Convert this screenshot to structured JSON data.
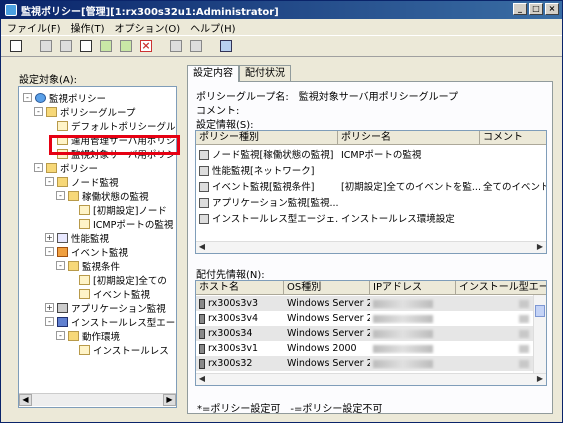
{
  "window": {
    "title": "監視ポリシー[管理][1:rx300s32u1:Administrator]"
  },
  "menu": [
    "ファイル(F)",
    "操作(T)",
    "オプション(O)",
    "ヘルプ(H)"
  ],
  "left": {
    "label": "設定対象(A):",
    "tree": [
      {
        "label": "監視ポリシー",
        "icon": "globe-icon",
        "level": 0,
        "exp": "-"
      },
      {
        "label": "ポリシーグループ",
        "icon": "folder-icon",
        "level": 1,
        "exp": "-"
      },
      {
        "label": "デフォルトポリシーグル",
        "icon": "doc-icon",
        "level": 2,
        "exp": ""
      },
      {
        "label": "運用管理サーバ用ポリシ",
        "icon": "doc-icon",
        "level": 2,
        "exp": ""
      },
      {
        "label": "監視対象サーバ用ポリシ",
        "icon": "doc-icon",
        "level": 2,
        "exp": "",
        "selected": true
      },
      {
        "label": "ポリシー",
        "icon": "folder-icon",
        "level": 1,
        "exp": "-"
      },
      {
        "label": "ノード監視",
        "icon": "folder-icon",
        "level": 2,
        "exp": "-"
      },
      {
        "label": "稼働状態の監視",
        "icon": "folder-icon",
        "level": 3,
        "exp": "-"
      },
      {
        "label": "[初期設定]ノード",
        "icon": "doc-icon",
        "level": 4,
        "exp": ""
      },
      {
        "label": "ICMPポートの監視",
        "icon": "doc-icon",
        "level": 4,
        "exp": ""
      },
      {
        "label": "性能監視",
        "icon": "chart-icon",
        "level": 2,
        "exp": "+"
      },
      {
        "label": "イベント監視",
        "icon": "warn-icon",
        "level": 2,
        "exp": "-"
      },
      {
        "label": "監視条件",
        "icon": "folder-icon",
        "level": 3,
        "exp": "-"
      },
      {
        "label": "[初期設定]全ての",
        "icon": "doc-icon",
        "level": 4,
        "exp": ""
      },
      {
        "label": "イベント監視",
        "icon": "doc-icon",
        "level": 4,
        "exp": ""
      },
      {
        "label": "アプリケーション監視",
        "icon": "app-icon",
        "level": 2,
        "exp": "+"
      },
      {
        "label": "インストールレス型エー",
        "icon": "inst-icon",
        "level": 2,
        "exp": "-"
      },
      {
        "label": "動作環境",
        "icon": "folder-icon",
        "level": 3,
        "exp": "-"
      },
      {
        "label": "インストールレス",
        "icon": "doc-icon",
        "level": 4,
        "exp": ""
      }
    ]
  },
  "tabs": [
    "設定内容",
    "配付状況"
  ],
  "info": {
    "group_label": "ポリシーグループ名:",
    "group_value": "監視対象サーバ用ポリシーグループ",
    "comment_label": "コメント:",
    "settings_label": "設定情報(S):"
  },
  "policy_table": {
    "headers": [
      "ポリシー種別",
      "ポリシー名",
      "コメント"
    ],
    "rows": [
      {
        "type": "ノード監視[稼働状態の監視]",
        "name": "ICMPポートの監視",
        "comment": "",
        "icon": "node-icon"
      },
      {
        "type": "性能監視[ネットワーク]",
        "name": "",
        "comment": "",
        "icon": "chart-icon"
      },
      {
        "type": "イベント監視[監視条件]",
        "name": "[初期設定]全てのイベントを監...",
        "comment": "全てのイベント",
        "icon": "warn-icon"
      },
      {
        "type": "アプリケーション監視[監視...",
        "name": "",
        "comment": "",
        "icon": "app-icon"
      },
      {
        "type": "インストールレス型エージェ...",
        "name": "インストールレス環境設定",
        "comment": "",
        "icon": "inst-icon"
      }
    ]
  },
  "dist_label": "配付先情報(N):",
  "host_table": {
    "headers": [
      "ホスト名",
      "OS種別",
      "IPアドレス",
      "インストール型エージ"
    ],
    "rows": [
      {
        "host": "rx300s3v3",
        "os": "Windows Server 2..."
      },
      {
        "host": "rx300s3v4",
        "os": "Windows Server 2..."
      },
      {
        "host": "rx300s34",
        "os": "Windows Server 2..."
      },
      {
        "host": "rx300s3v1",
        "os": "Windows 2000"
      },
      {
        "host": "rx300s32",
        "os": "Windows Server 2..."
      }
    ]
  },
  "footnote": "*=ポリシー設定可　-=ポリシー設定不可"
}
